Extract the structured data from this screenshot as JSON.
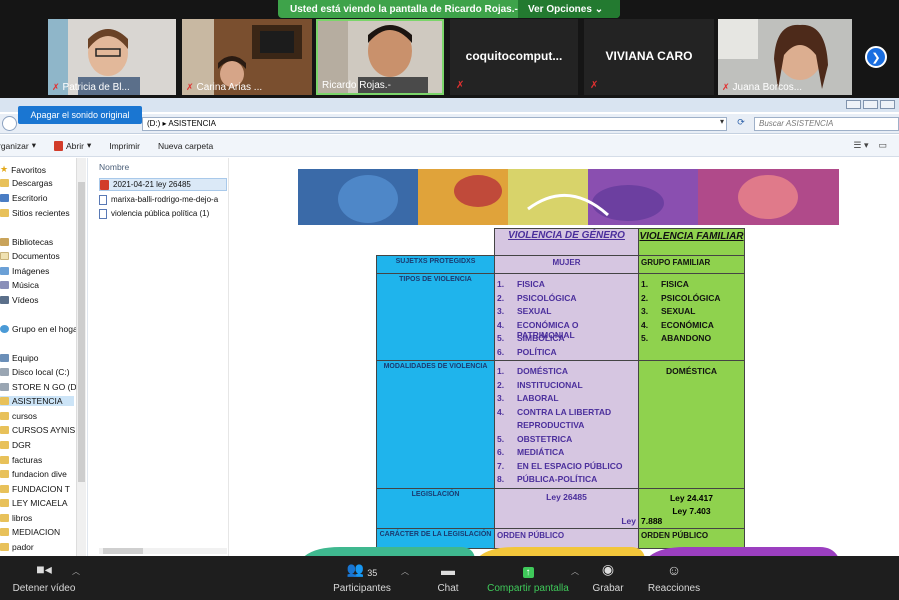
{
  "share_banner": {
    "text": "Usted está viendo la pantalla de Ricardo Rojas.-",
    "options": "Ver Opciones"
  },
  "participants_tiles": [
    {
      "name": "Patricia de Bl..."
    },
    {
      "name": "Carina Arias ..."
    },
    {
      "name": "Ricardo Rojas.-"
    },
    {
      "name": "coquitocomput..."
    },
    {
      "name": "VIVIANA CARO"
    },
    {
      "name": "Juana Borcos..."
    }
  ],
  "explorer": {
    "tooltip_button": "Apagar el sonido original",
    "address": "(D:) ▸ ASISTENCIA",
    "search_placeholder": "Buscar ASISTENCIA",
    "toolbar": {
      "organize": "rganizar",
      "open": "Abrir",
      "print": "Imprimir",
      "new_folder": "Nueva carpeta"
    },
    "column_header": "Nombre",
    "nav": [
      "Favoritos",
      "Descargas",
      "Escritorio",
      "Sitios recientes",
      "Bibliotecas",
      "Documentos",
      "Imágenes",
      "Música",
      "Vídeos",
      "Grupo en el hogar",
      "Equipo",
      "Disco local (C:)",
      "STORE N GO (D:)",
      "ASISTENCIA",
      "cursos",
      "CURSOS AYNIS",
      "DGR",
      "facturas",
      "fundacion dive",
      "FUNDACION T",
      "LEY MICAELA",
      "libros",
      "MEDIACION",
      "pador"
    ],
    "files": [
      "2021-04-21 ley 26485",
      "marixa-balli-rodrigo-me-dejo-a",
      "violencia pública política (1)"
    ]
  },
  "document": {
    "header_genero": "VIOLENCIA DE GÉNERO",
    "header_familiar": "VIOLENCIA FAMILIAR",
    "rows": {
      "sujetos": {
        "label": "SUJETXS PROTEGIDXS",
        "genero": "MUJER",
        "familiar": "GRUPO FAMILIAR"
      },
      "tipos": {
        "label": "TIPOS DE VIOLENCIA",
        "genero": [
          "FISICA",
          "PSICOLÓGICA",
          "SEXUAL",
          "ECONÓMICA O PATRIMONIAL",
          "SIMBÓLICA",
          "POLÍTICA"
        ],
        "familiar": [
          "FISICA",
          "PSICOLÓGICA",
          "SEXUAL",
          "ECONÓMICA",
          "ABANDONO"
        ]
      },
      "modalidades": {
        "label": "MODALIDADES DE VIOLENCIA",
        "genero": [
          "DOMÉSTICA",
          "INSTITUCIONAL",
          "LABORAL",
          "CONTRA LA LIBERTAD",
          "REPRODUCTIVA",
          "OBSTETRICA",
          "MEDIÁTICA",
          "EN EL ESPACIO PÚBLICO",
          "PÚBLICA-POLÍTICA"
        ],
        "genero_numbers": [
          "1.",
          "2.",
          "3.",
          "4.",
          "",
          "5.",
          "6.",
          "7.",
          "8."
        ],
        "familiar": "DOMÉSTICA"
      },
      "legislacion": {
        "label": "LEGISLACIÓN",
        "genero": "Ley 26485",
        "familiar_1": "Ley  24.417",
        "familiar_2": "Ley 7.403",
        "familiar_3_prefix": "Ley",
        "familiar_3": "7.888"
      },
      "caracter": {
        "label": "CARÁCTER DE LA LEGISLACIÓN",
        "genero": "ORDEN PÚBLICO",
        "familiar": "ORDEN PÚBLICO"
      }
    }
  },
  "zoom_toolbar": {
    "stop_video": "Detener vídeo",
    "participants": "Participantes",
    "participants_count": "35",
    "chat": "Chat",
    "share": "Compartir pantalla",
    "record": "Grabar",
    "reactions": "Reacciones"
  },
  "colors": {
    "share_green": "#3ea34a",
    "table_blue": "#1fb4ec",
    "table_lavender": "#d6c6e1",
    "table_green": "#8fd24e"
  }
}
